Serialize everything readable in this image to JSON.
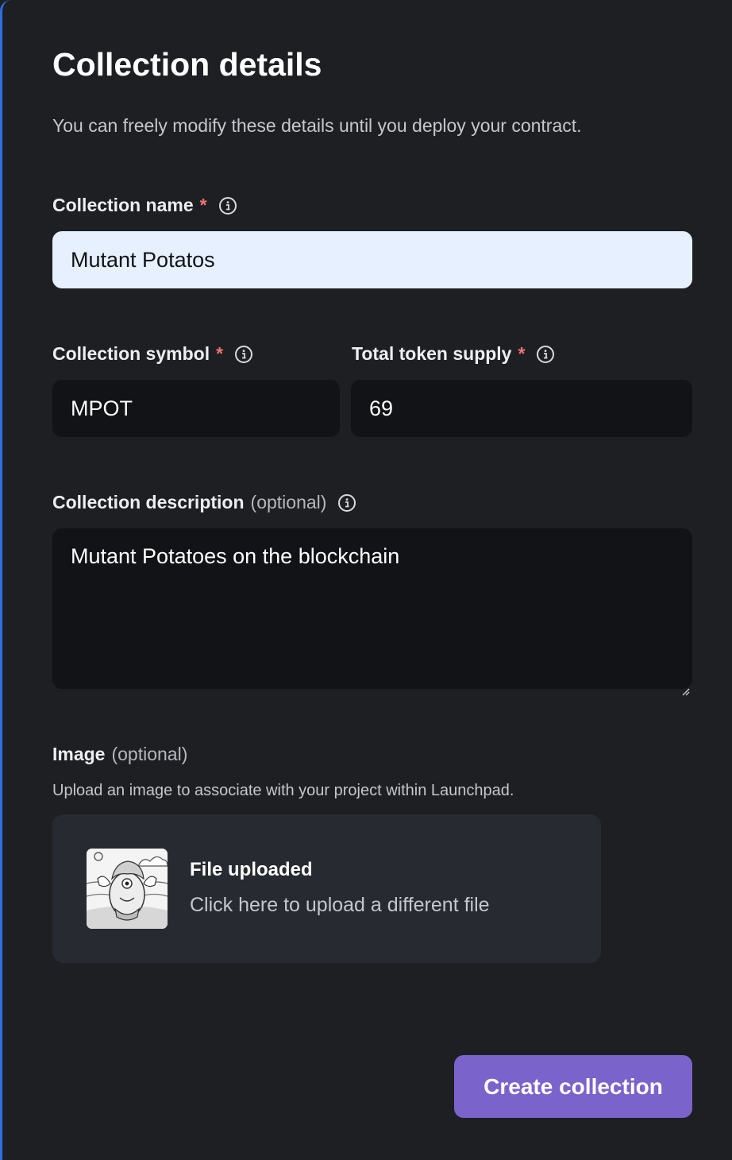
{
  "form": {
    "title": "Collection details",
    "subtitle": "You can freely modify these details until you deploy your contract.",
    "required_marker": "*",
    "name": {
      "label": "Collection name",
      "value": "Mutant Potatos"
    },
    "symbol": {
      "label": "Collection symbol",
      "value": "MPOT"
    },
    "supply": {
      "label": "Total token supply",
      "value": "69"
    },
    "description": {
      "label": "Collection description",
      "optional": "(optional)",
      "value": "Mutant Potatoes on the blockchain"
    },
    "image": {
      "label": "Image",
      "optional": "(optional)",
      "hint": "Upload an image to associate with your project within Launchpad.",
      "status": "File uploaded",
      "action": "Click here to upload a different file"
    },
    "submit_label": "Create collection"
  },
  "colors": {
    "background": "#1d1f22",
    "input_dark": "#121316",
    "input_light": "#e7f0fe",
    "required": "#f0736e",
    "primary_button": "#7b63cc",
    "upload_box": "#272a31"
  }
}
